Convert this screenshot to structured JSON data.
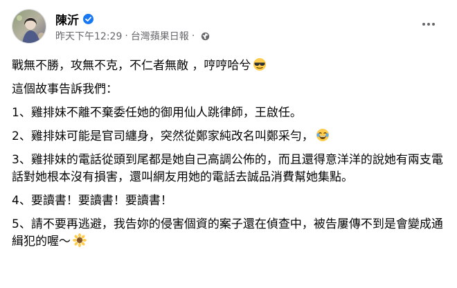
{
  "post": {
    "author": "陳沂",
    "time": "昨天下午12:29",
    "separator": "·",
    "source": "台灣蘋果日報",
    "paragraphs": [
      "戰無不勝，攻無不克，不仁者無敵 ，哼哼哈兮",
      "這個故事告訴我們：",
      "1、雞排妹不離不棄委任她的御用仙人跳律師，王啟任。",
      "2、雞排妹可能是官司纏身，突然從鄭家純改名叫鄭采勻，",
      "3、雞排妹的電話從頭到尾都是她自己高調公佈的，而且還得意洋洋的說她有兩支電話對她根本沒有損害，還叫網友用她的電話去誠品消費幫她集點。",
      "4、要讀書！要讀書！要讀書！",
      "5、請不要再逃避，我告妳的侵害個資的案子還在偵查中，被告屢傳不到是會變成通緝犯的喔～"
    ],
    "emojis": {
      "p0": "sunglasses-emoji",
      "p3": "tears-of-joy-emoji",
      "p6": "sunflower-emoji"
    },
    "colors": {
      "verified": "#1877f2",
      "meta_text": "#65676b",
      "body_text": "#050505"
    }
  }
}
